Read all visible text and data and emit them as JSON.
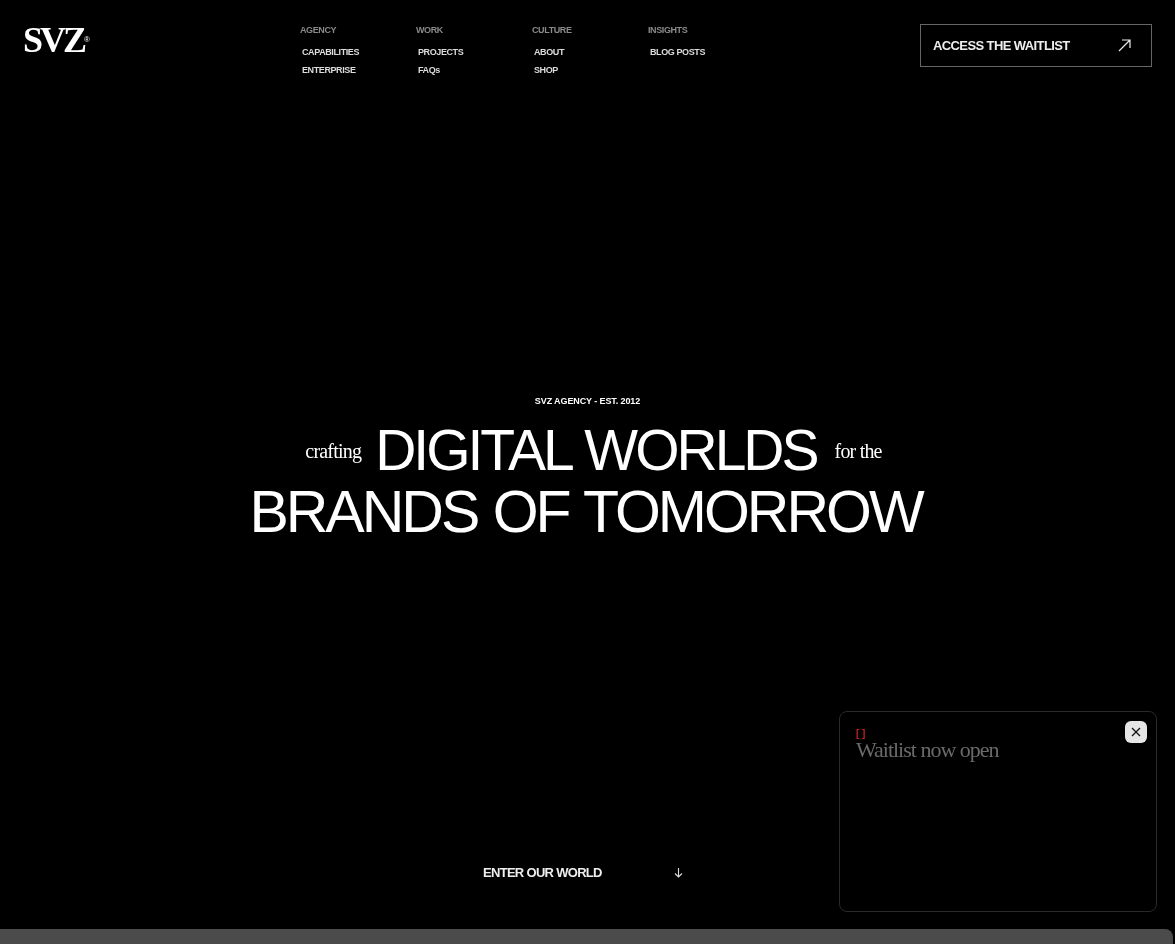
{
  "logo": {
    "text": "SVZ",
    "mark": "®"
  },
  "nav": [
    {
      "heading": "AGENCY",
      "links": [
        "CAPABILITIES",
        "ENTERPRISE"
      ]
    },
    {
      "heading": "WORK",
      "links": [
        "PROJECTS",
        "FAQs"
      ]
    },
    {
      "heading": "CULTURE",
      "links": [
        "ABOUT",
        "SHOP"
      ]
    },
    {
      "heading": "INSIGHTS",
      "links": [
        "BLOG POSTS"
      ]
    }
  ],
  "cta": {
    "label": "ACCESS THE WAITLIST"
  },
  "hero": {
    "eyebrow": "SVZ AGENCY - EST. 2012",
    "lead": "crafting",
    "headline_1": "DIGITAL WORLDS",
    "connector": "for the",
    "headline_2": "BRANDS OF TOMORROW"
  },
  "enter": {
    "label": "ENTER OUR WORLD"
  },
  "popup": {
    "bracket": "[ ]",
    "title": "Waitlist now open"
  }
}
